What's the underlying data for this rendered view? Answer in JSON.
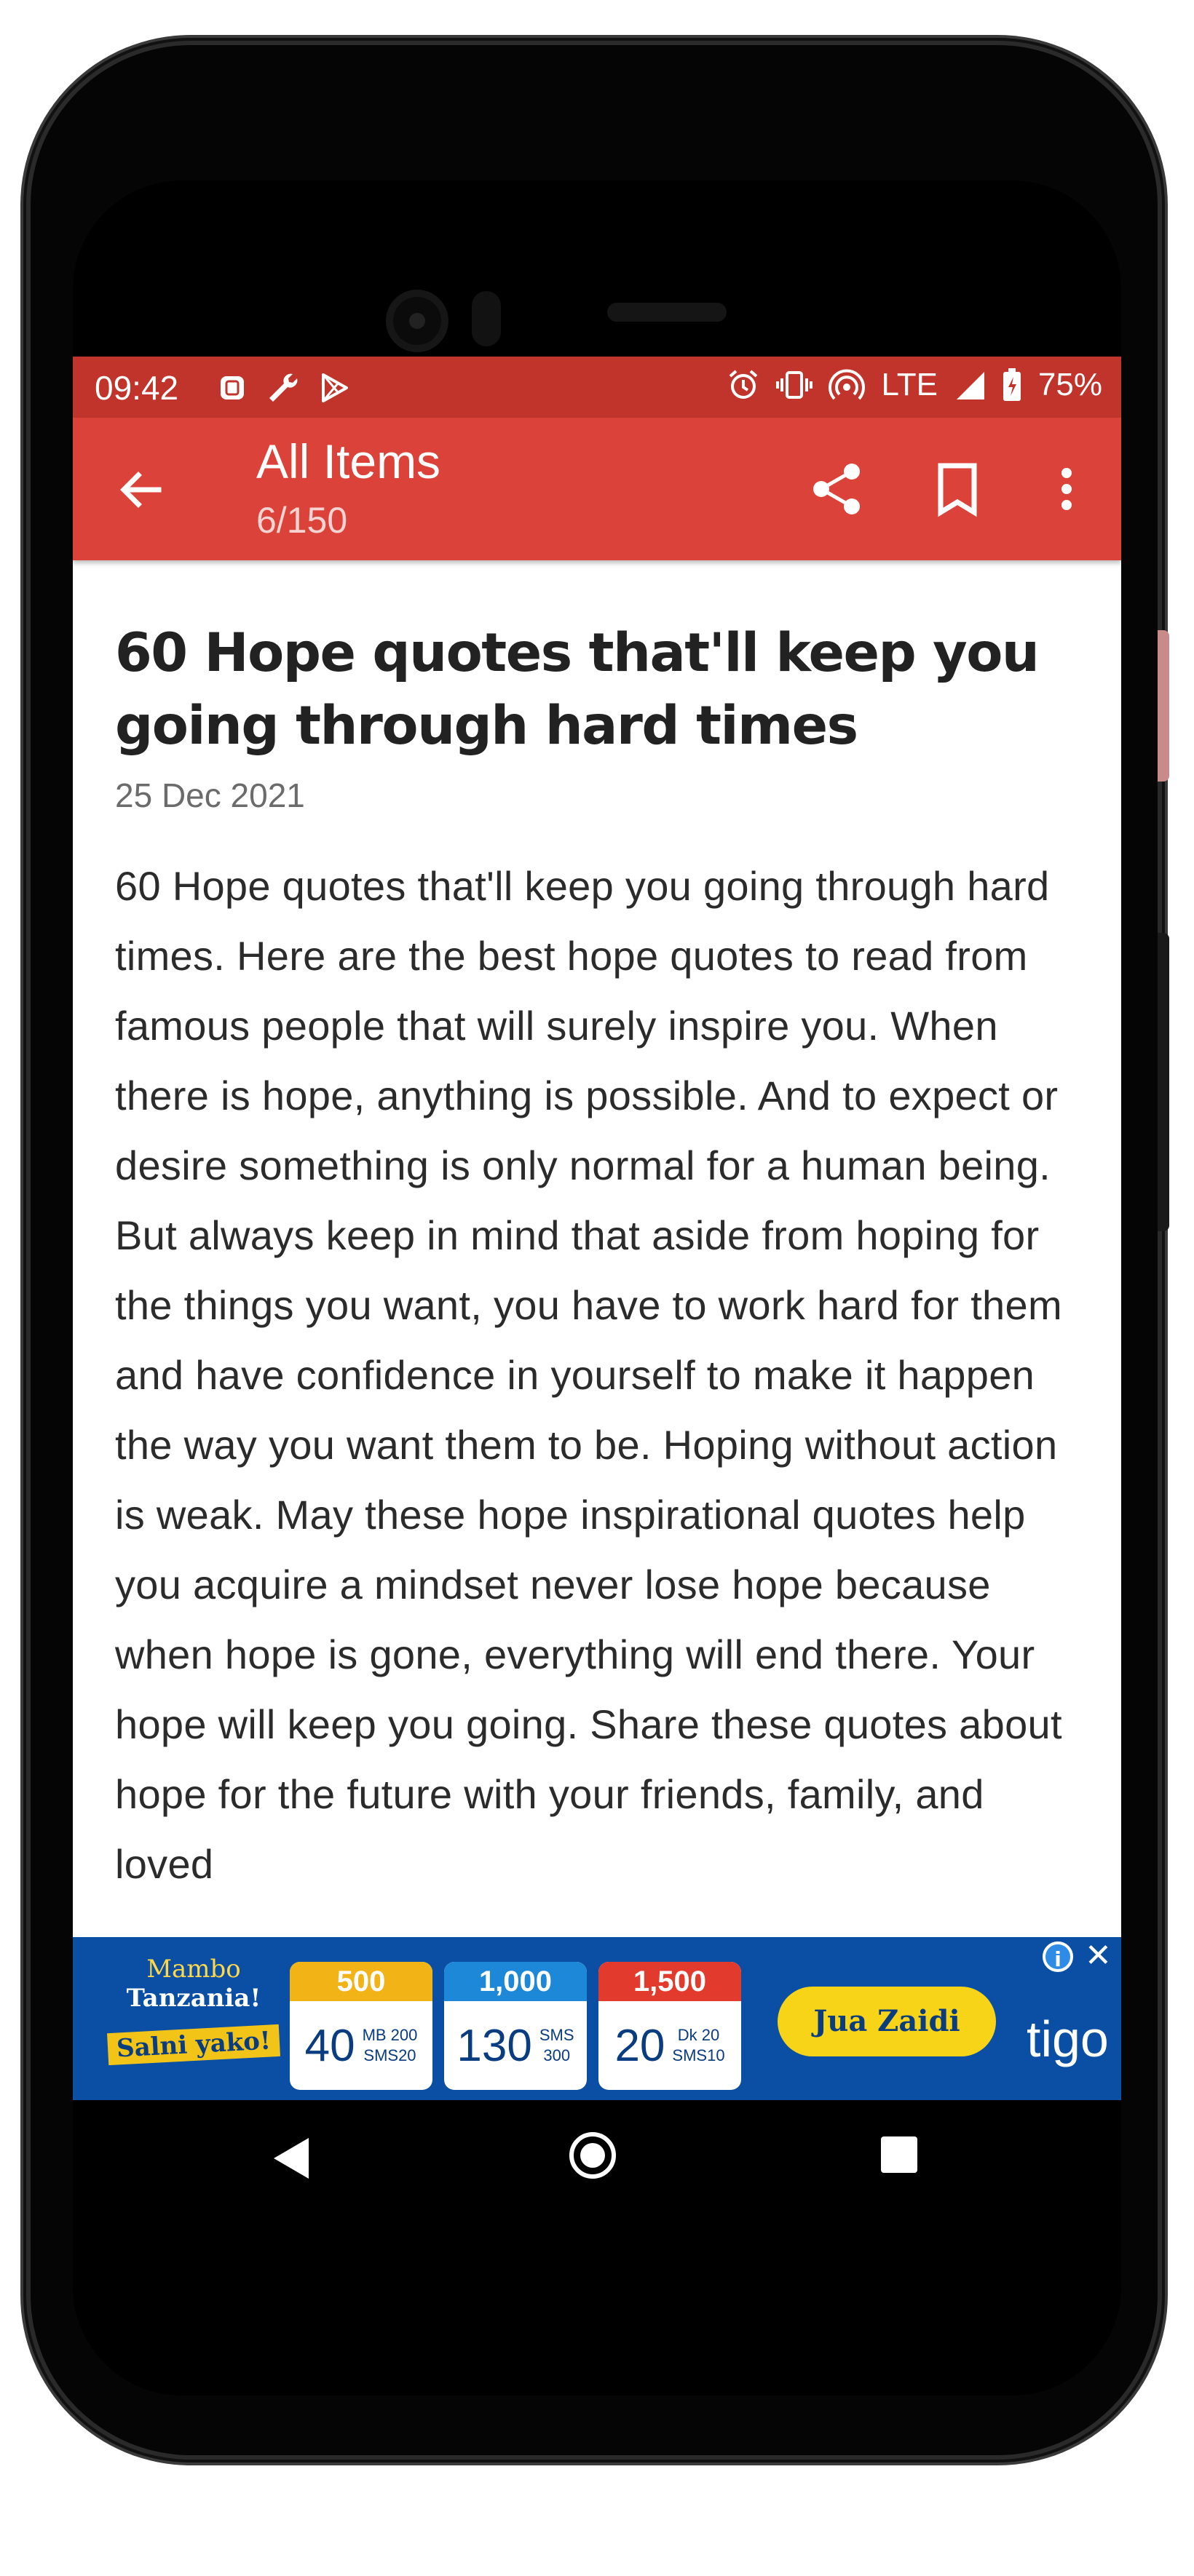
{
  "status_bar": {
    "time": "09:42",
    "network": "LTE",
    "battery": "75%",
    "icons": [
      "app-notification-icon",
      "wrench-icon",
      "play-store-icon",
      "alarm-icon",
      "vibrate-icon",
      "hotspot-icon",
      "signal-icon",
      "battery-icon"
    ]
  },
  "app_bar": {
    "title": "All Items",
    "subtitle": "6/150",
    "accent_color": "#db433a"
  },
  "article": {
    "title": "60 Hope quotes that'll keep you going through hard times",
    "date": "25 Dec 2021",
    "body": "60 Hope quotes that'll keep you going through hard times. Here are the best hope quotes to read from famous people that will surely inspire you. When there is hope, anything is possible. And to expect or desire something is only normal for a human being. But always keep in mind that aside from hoping for the things you want, you have to work hard for them and have confidence in yourself to make it happen the way you want them to be. Hoping without action is weak. May these hope inspirational quotes help you acquire a mindset never lose hope because when hope is gone, everything will end there. Your hope will keep you going. Share these quotes about hope for the future with your friends, family, and loved"
  },
  "ad": {
    "brand_line1": "Mambo",
    "brand_line2": "Tanzania!",
    "brand_tag": "Salni yako!",
    "bundles": [
      {
        "price": "500",
        "big": "40",
        "small1": "MB 200",
        "small2": "SMS20",
        "color": "#f2b316"
      },
      {
        "price": "1,000",
        "big": "130",
        "small1": "SMS",
        "small2": "300",
        "color": "#1e88d8"
      },
      {
        "price": "1,500",
        "big": "20",
        "small1": "Dk 20",
        "small2": "SMS10",
        "color": "#e23b2e"
      }
    ],
    "cta": "Jua Zaidi",
    "logo": "tigo"
  }
}
